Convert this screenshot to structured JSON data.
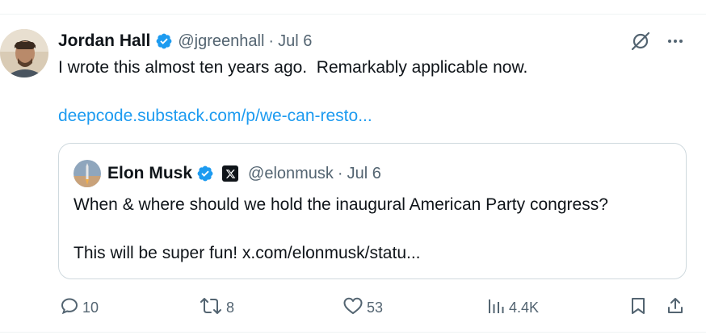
{
  "tweet": {
    "author_name": "Jordan Hall",
    "handle": "@jgreenhall",
    "separator": "·",
    "date": "Jul 6",
    "text": "I wrote this almost ten years ago.  Remarkably applicable now.",
    "link": "deepcode.substack.com/p/we-can-resto...",
    "verified_color": "#1d9bf0"
  },
  "quote": {
    "author_name": "Elon Musk",
    "handle": "@elonmusk",
    "separator": "·",
    "date": "Jul 6",
    "line1": "When & where should we hold the inaugural American Party congress?",
    "line2": "This will be super fun! x.com/elonmusk/statu...",
    "affiliate_icon": "x-logo-icon"
  },
  "actions": {
    "replies": "10",
    "reposts": "8",
    "likes": "53",
    "views": "4.4K"
  },
  "colors": {
    "text": "#0f1419",
    "secondary": "#536471",
    "accent": "#1d9bf0",
    "border": "#cfd9de"
  }
}
